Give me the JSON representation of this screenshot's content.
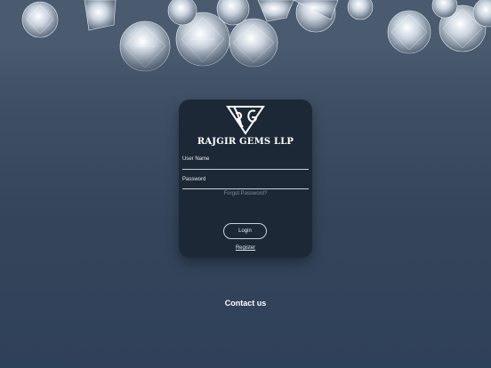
{
  "brand": {
    "name": "RAJGIR GEMS LLP",
    "logo_icon": "rg-monogram-icon"
  },
  "login_form": {
    "username_label": "User Name",
    "username_value": "",
    "password_label": "Password",
    "password_value": "",
    "forgot_password": "Forgot Password?",
    "login_button": "Login",
    "register_link": "Register"
  },
  "footer": {
    "contact": "Contact us"
  },
  "colors": {
    "background": "#3f4f63",
    "card": "#1c2836",
    "text": "#ffffff",
    "muted": "#7e8da0"
  }
}
